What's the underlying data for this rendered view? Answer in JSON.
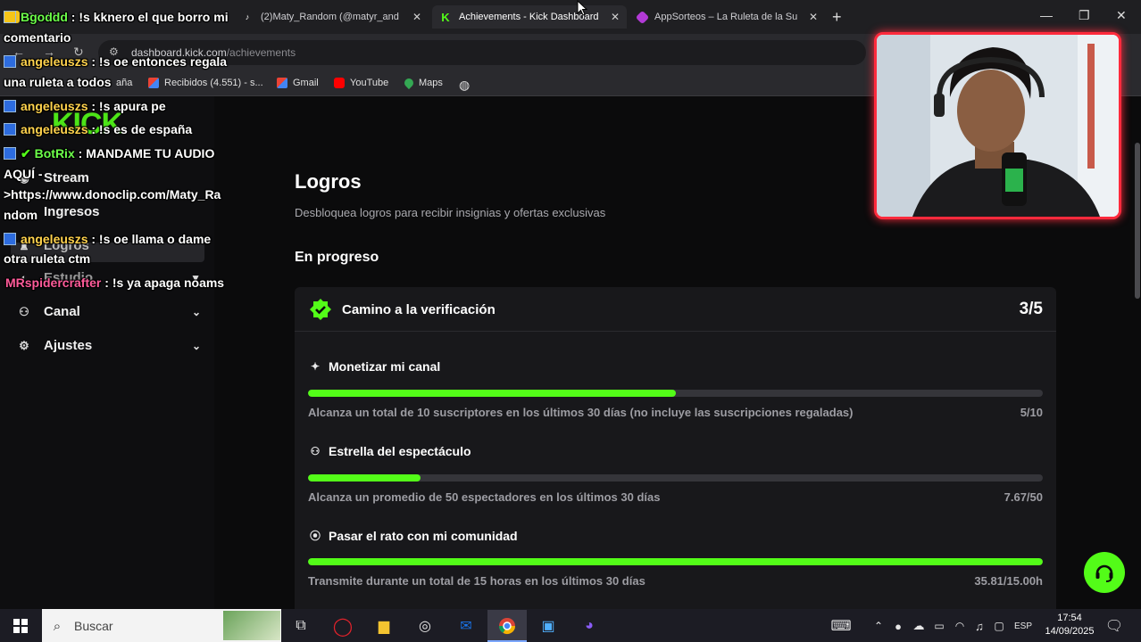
{
  "browser": {
    "tabs": [
      {
        "title": "Bgoddd",
        "active": false
      },
      {
        "title": "(2)Maty_Random (@matyr_and",
        "active": false
      },
      {
        "title": "Achievements - Kick Dashboard",
        "active": true
      },
      {
        "title": "AppSorteos – La Ruleta de la Su",
        "active": false
      }
    ],
    "new_tab": "+",
    "url_host": "dashboard.kick.com",
    "url_path": "/achievements",
    "bookmarks": [
      "aña",
      "Recibidos (4.551) - s...",
      "Gmail",
      "YouTube",
      "Maps"
    ]
  },
  "sidebar": {
    "logo": "KICK",
    "items": [
      {
        "label": "Stream",
        "icon": "broadcast-icon"
      },
      {
        "label": "Ingresos",
        "icon": "money-icon"
      },
      {
        "label": "Logros",
        "icon": "trophy-icon"
      },
      {
        "label": "Estudio",
        "icon": "studio-icon"
      },
      {
        "label": "Canal",
        "icon": "users-icon"
      },
      {
        "label": "Ajustes",
        "icon": "gear-icon"
      }
    ]
  },
  "main": {
    "title": "Logros",
    "subtitle": "Desbloquea logros para recibir insignias y ofertas exclusivas",
    "section": "En progreso",
    "card": {
      "title": "Camino a la verificación",
      "count": "3/5",
      "achievements": [
        {
          "title": "Monetizar mi canal",
          "icon": "sparkle-icon",
          "desc": "Alcanza un total de 10 suscriptores en los últimos 30 días (no incluye las suscripciones regaladas)",
          "value": "5/10",
          "progress": 0.5
        },
        {
          "title": "Estrella del espectáculo",
          "icon": "users-icon",
          "desc": "Alcanza un promedio de 50 espectadores en los últimos 30 días",
          "value": "7.67/50",
          "progress": 0.153
        },
        {
          "title": "Pasar el rato con mi comunidad",
          "icon": "broadcast-icon",
          "desc": "Transmite durante un total de 15 horas en los últimos 30 días",
          "value": "35.81/15.00h",
          "progress": 1.0
        }
      ]
    }
  },
  "chat": [
    {
      "user": "Bgoddd",
      "text": ": !s kknero el que borro mi",
      "cont": "comentario"
    },
    {
      "user": "angeleuszs",
      "text": ": !s oe entonces regala",
      "cont": "una ruleta a todos"
    },
    {
      "user": "angeleuszs",
      "text": ": !s apura pe"
    },
    {
      "user": "angeleuszs",
      "text": ": !s es de españa"
    },
    {
      "user": "BotRix",
      "text": ": MANDAME TU AUDIO",
      "cont": "AQUÍ -",
      "cont2": ">https://www.donoclip.com/Maty_Ra",
      "cont3": "ndom"
    },
    {
      "user": "angeleuszs",
      "text": ": !s oe llama o dame",
      "cont": "otra ruleta ctm"
    },
    {
      "user": "MRspidercrafter",
      "text": ": !s ya apaga noams"
    }
  ],
  "taskbar": {
    "search": "Buscar",
    "lang": "ESP",
    "time": "17:54",
    "date": "14/09/2025"
  }
}
